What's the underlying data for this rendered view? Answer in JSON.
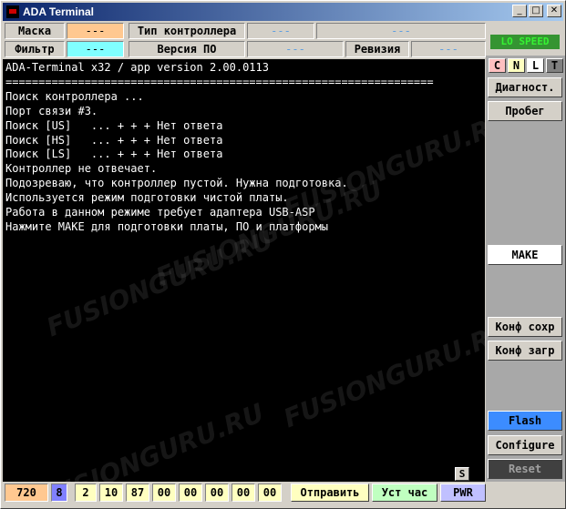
{
  "window": {
    "title": "ADA Terminal",
    "min": "_",
    "max": "□",
    "close": "✕"
  },
  "header": {
    "mask_label": "Маска",
    "mask_value": "---",
    "filter_label": "Фильтр",
    "filter_value": "---",
    "controller_type_label": "Тип контроллера",
    "controller_type_value1": "---",
    "controller_type_value2": "---",
    "version_label": "Версия ПО",
    "version_value": "---",
    "revision_label": "Ревизия",
    "revision_value": "---",
    "speed_badge": "LO SPEED"
  },
  "terminal": {
    "lines": [
      "ADA-Terminal x32 / app version 2.00.0113",
      "=================================================================",
      "Поиск контроллера ...",
      "Порт связи #3.",
      "Поиск [US]   ... + + + Нет ответа",
      "Поиск [HS]   ... + + + Нет ответа",
      "Поиск [LS]   ... + + + Нет ответа",
      "Контроллер не отвечает.",
      "Подозреваю, что контроллер пустой. Нужна подготовка.",
      "Используется режим подготовки чистой платы.",
      "Работа в данном режиме требует адаптера USB-ASP",
      "Нажмите MAKE для подготовки платы, ПО и платформы"
    ],
    "watermark": "FUSIONGURU.RU",
    "s_button": "S"
  },
  "side": {
    "toggles": [
      "C",
      "N",
      "L",
      "T"
    ],
    "toggle_colors": [
      "#ffc0c0",
      "#ffffc0",
      "#ffffff",
      "#808080"
    ],
    "diag_button": "Диагност.",
    "run_button": "Пробег",
    "make_button": "MAKE",
    "conf_save_button": "Конф сохр",
    "conf_load_button": "Конф загр",
    "flash_button": "Flash",
    "configure_button": "Configure",
    "reset_button": "Reset"
  },
  "bottom": {
    "cells": [
      "720",
      "8",
      "2",
      "10",
      "87",
      "00",
      "00",
      "00",
      "00",
      "00"
    ],
    "send_button": "Отправить",
    "set_clock_button": "Уст час",
    "pwr_button": "PWR"
  },
  "colors": {
    "terminal_bg": "#000000",
    "terminal_fg": "#ffffff",
    "mask_bg": "#ffc890",
    "filter_bg": "#80ffff",
    "flash_bg": "#3c8cff",
    "speed_bg": "#008000"
  }
}
